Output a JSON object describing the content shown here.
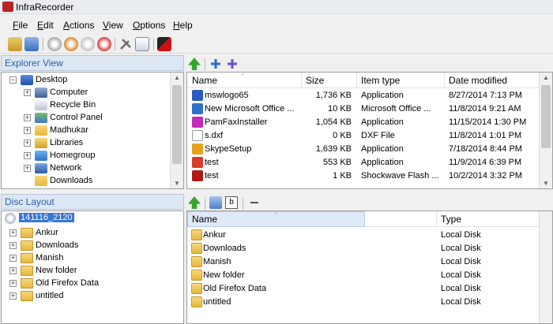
{
  "window": {
    "title": "InfraRecorder"
  },
  "menu": [
    {
      "label": "File",
      "u": "F",
      "rest": "ile"
    },
    {
      "label": "Edit",
      "u": "E",
      "rest": "dit"
    },
    {
      "label": "Actions",
      "u": "A",
      "rest": "ctions"
    },
    {
      "label": "View",
      "u": "V",
      "rest": "iew"
    },
    {
      "label": "Options",
      "u": "O",
      "rest": "ptions"
    },
    {
      "label": "Help",
      "u": "H",
      "rest": "elp"
    }
  ],
  "explorer": {
    "title": "Explorer View",
    "tree": [
      {
        "label": "Desktop",
        "icon": "desktop-icon",
        "expander": "-"
      },
      {
        "label": "Computer",
        "icon": "computer-icon",
        "expander": "+"
      },
      {
        "label": "Recycle Bin",
        "icon": "recycle-bin-icon",
        "expander": ""
      },
      {
        "label": "Control Panel",
        "icon": "control-panel-icon",
        "expander": "+"
      },
      {
        "label": "Madhukar",
        "icon": "user-folder-icon",
        "expander": "+"
      },
      {
        "label": "Libraries",
        "icon": "libraries-icon",
        "expander": "+"
      },
      {
        "label": "Homegroup",
        "icon": "homegroup-icon",
        "expander": "+"
      },
      {
        "label": "Network",
        "icon": "network-icon",
        "expander": "+"
      },
      {
        "label": "Downloads",
        "icon": "folder-icon",
        "expander": ""
      }
    ],
    "columns": [
      "Name",
      "Size",
      "Item type",
      "Date modified"
    ],
    "files": [
      {
        "name": "mswlogo65",
        "size": "1,736 KB",
        "type": "Application",
        "date": "8/27/2014 7:13 PM",
        "icon": "#2a5bbd"
      },
      {
        "name": "New Microsoft Office ...",
        "size": "10 KB",
        "type": "Microsoft Office ...",
        "date": "11/8/2014 9:21 AM",
        "icon": "#2f6fc8"
      },
      {
        "name": "PamFaxInstaller",
        "size": "1,054 KB",
        "type": "Application",
        "date": "11/15/2014 1:30 PM",
        "icon": "#c02bb8"
      },
      {
        "name": "s.dxf",
        "size": "0 KB",
        "type": "DXF File",
        "date": "11/8/2014 1:01 PM",
        "icon": "#ffffff"
      },
      {
        "name": "SkypeSetup",
        "size": "1,639 KB",
        "type": "Application",
        "date": "7/18/2014 8:44 PM",
        "icon": "#e6a21c"
      },
      {
        "name": "test",
        "size": "553 KB",
        "type": "Application",
        "date": "11/9/2014 6:39 PM",
        "icon": "#d83a2a"
      },
      {
        "name": "test",
        "size": "1 KB",
        "type": "Shockwave Flash ...",
        "date": "10/2/2014 3:32 PM",
        "icon": "#b01818"
      }
    ]
  },
  "disc": {
    "title": "Disc Layout",
    "root": "141116_2120",
    "tree": [
      "Ankur",
      "Downloads",
      "Manish",
      "New folder",
      "Old Firefox Data",
      "untitled"
    ],
    "columns": [
      "Name",
      "Type"
    ],
    "items": [
      {
        "name": "Ankur",
        "type": "Local Disk"
      },
      {
        "name": "Downloads",
        "type": "Local Disk"
      },
      {
        "name": "Manish",
        "type": "Local Disk"
      },
      {
        "name": "New folder",
        "type": "Local Disk"
      },
      {
        "name": "Old Firefox Data",
        "type": "Local Disk"
      },
      {
        "name": "untitled",
        "type": "Local Disk"
      }
    ]
  }
}
